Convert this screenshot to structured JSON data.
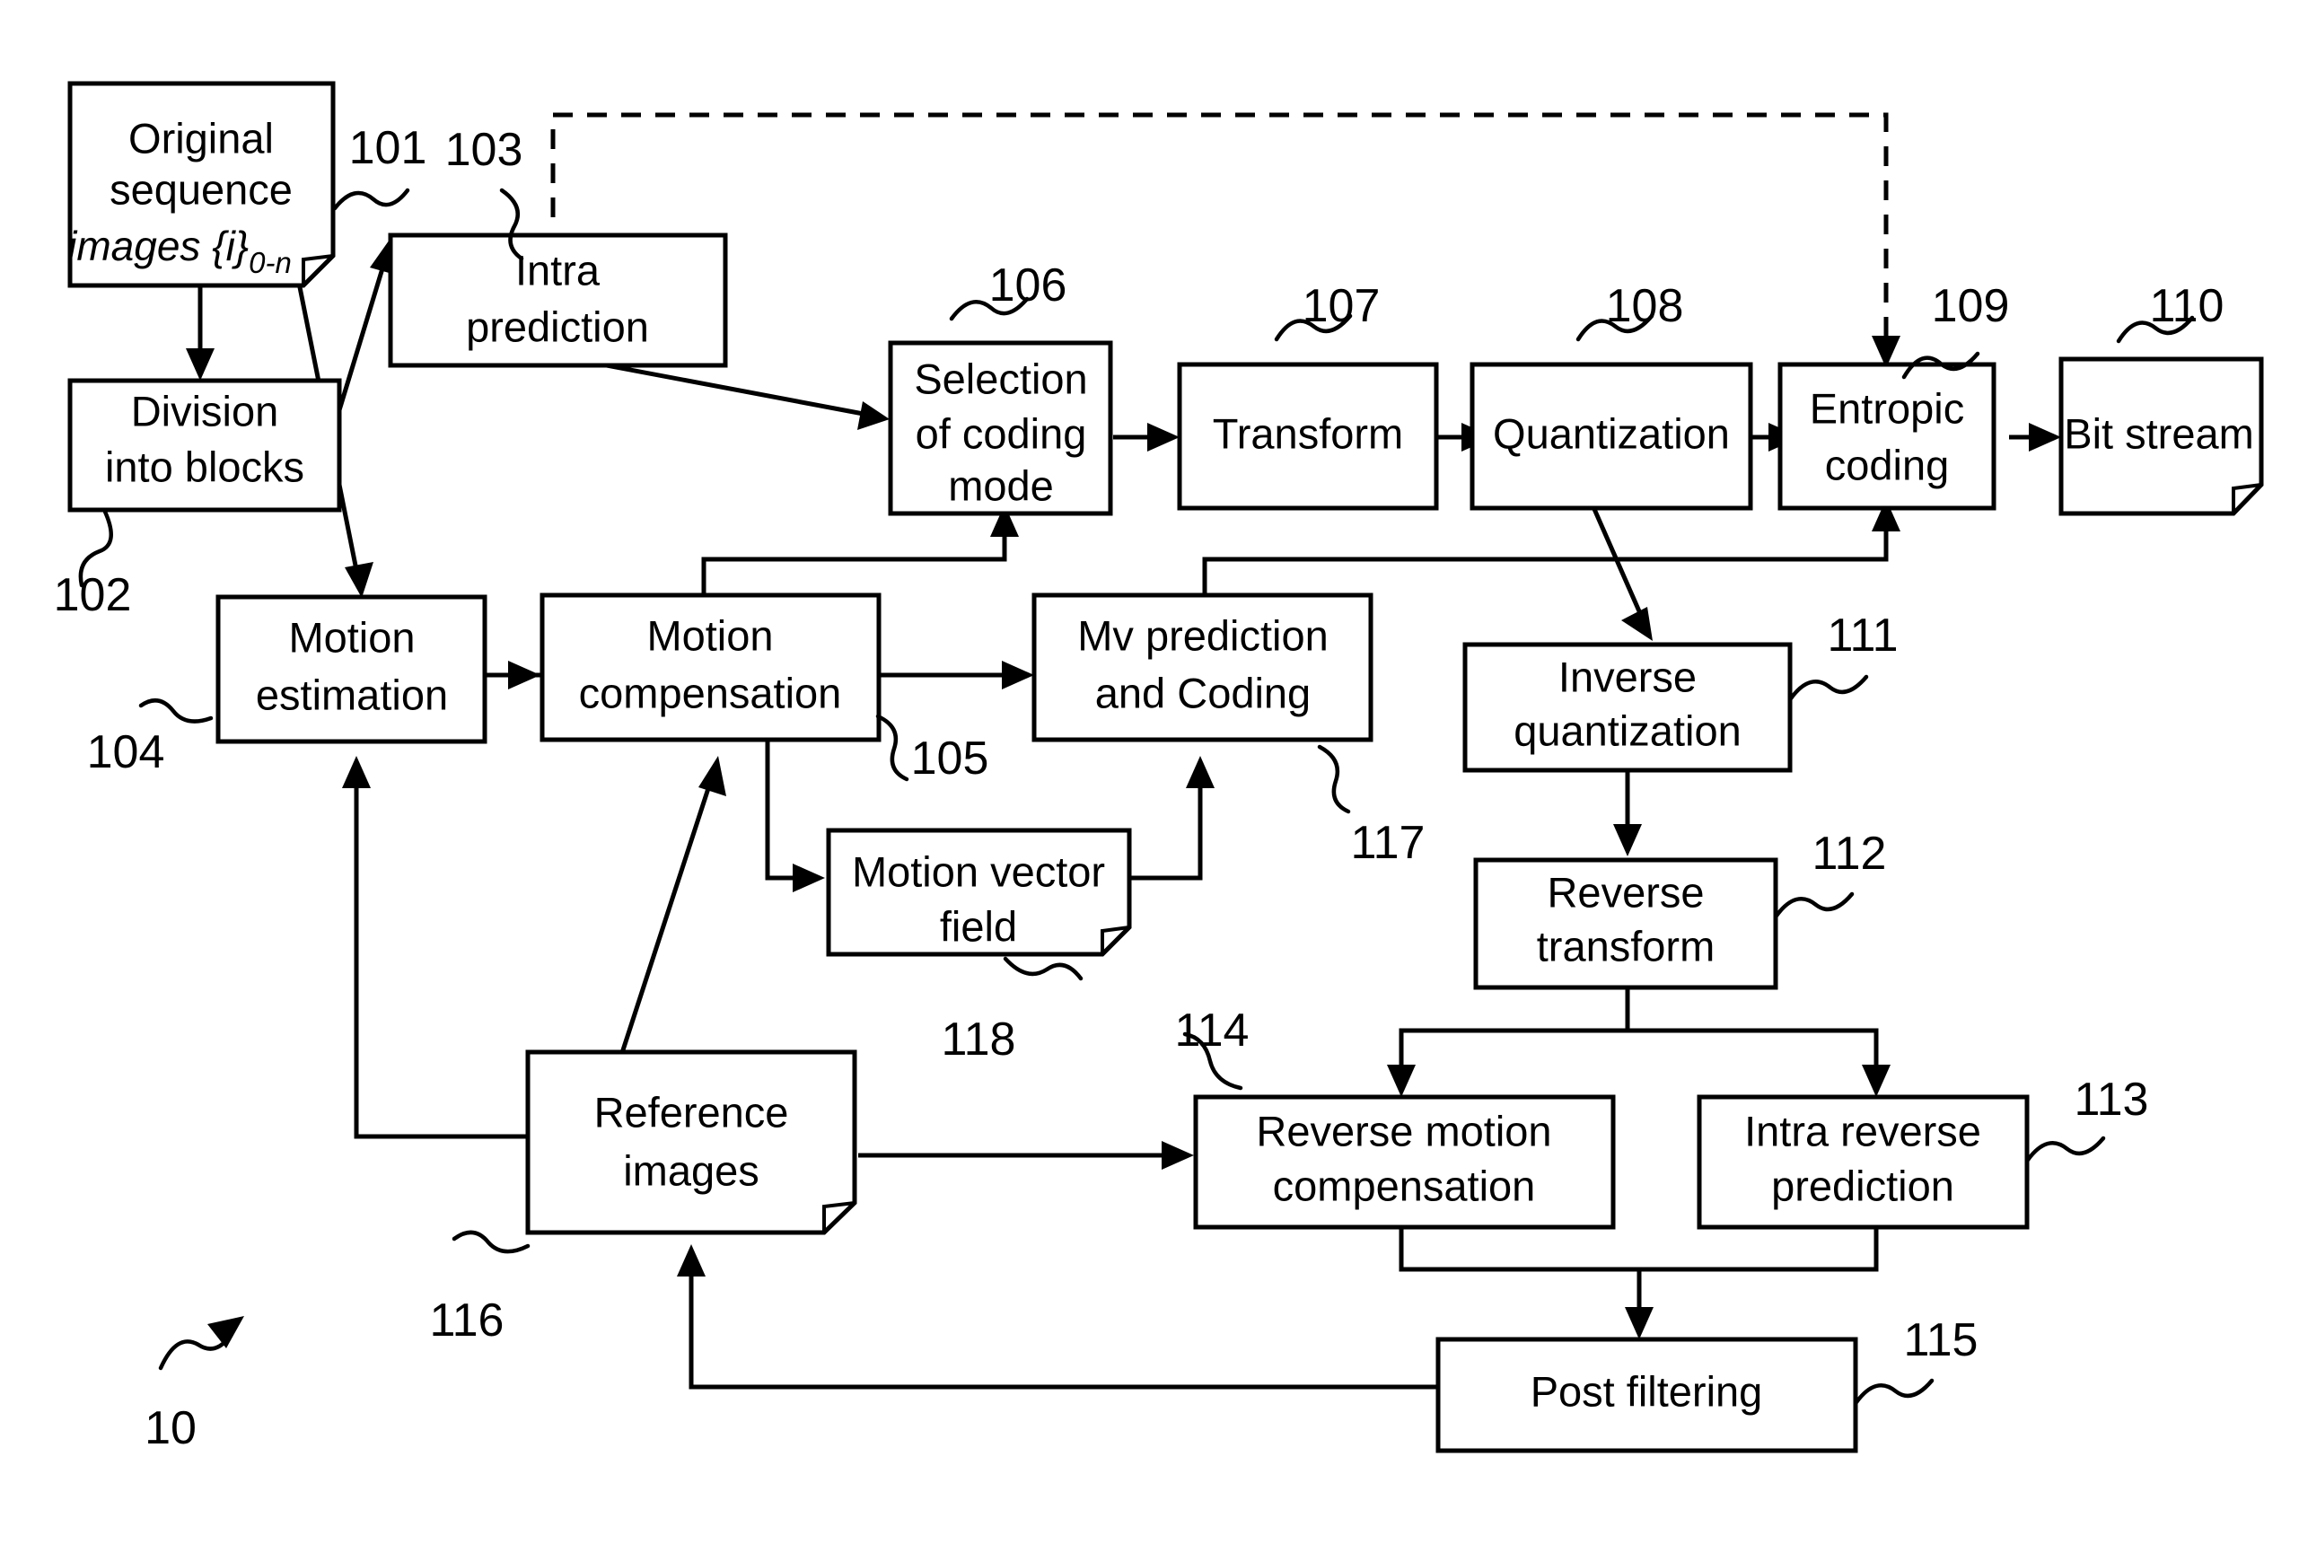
{
  "figure": {
    "figure_ref": "10",
    "background": "#ffffff",
    "ink": "#000000"
  },
  "blocks": [
    {
      "id": "original-sequence",
      "ref": "101",
      "line1": "Original",
      "line2": "sequence",
      "line3_italic": "images {i}",
      "line3_sub": "0-n",
      "shape": "document"
    },
    {
      "id": "division-into-blocks",
      "ref": "102",
      "line1": "Division",
      "line2": "into blocks",
      "shape": "rect"
    },
    {
      "id": "intra-prediction",
      "ref": "103",
      "line1": "Intra",
      "line2": "prediction",
      "shape": "rect"
    },
    {
      "id": "motion-estimation",
      "ref": "104",
      "line1": "Motion",
      "line2": "estimation",
      "shape": "rect"
    },
    {
      "id": "motion-compensation",
      "ref": "105",
      "line1": "Motion",
      "line2": "compensation",
      "shape": "rect"
    },
    {
      "id": "selection-of-coding-mode",
      "ref": "106",
      "line1": "Selection",
      "line2": "of coding",
      "line3": "mode",
      "shape": "rect"
    },
    {
      "id": "transform",
      "ref": "107",
      "line1": "Transform",
      "shape": "rect"
    },
    {
      "id": "quantization",
      "ref": "108",
      "line1": "Quantization",
      "shape": "rect"
    },
    {
      "id": "entropic-coding",
      "ref": "109",
      "line1": "Entropic",
      "line2": "coding",
      "shape": "rect"
    },
    {
      "id": "bit-stream",
      "ref": "110",
      "line1": "Bit stream",
      "shape": "document"
    },
    {
      "id": "inverse-quantization",
      "ref": "111",
      "line1": "Inverse",
      "line2": "quantization",
      "shape": "rect"
    },
    {
      "id": "reverse-transform",
      "ref": "112",
      "line1": "Reverse",
      "line2": "transform",
      "shape": "rect"
    },
    {
      "id": "intra-reverse-prediction",
      "ref": "113",
      "line1": "Intra reverse",
      "line2": "prediction",
      "shape": "rect"
    },
    {
      "id": "reverse-motion-compensation",
      "ref": "114",
      "line1": "Reverse motion",
      "line2": "compensation",
      "shape": "rect"
    },
    {
      "id": "post-filtering",
      "ref": "115",
      "line1": "Post filtering",
      "shape": "rect"
    },
    {
      "id": "reference-images",
      "ref": "116",
      "line1": "Reference",
      "line2": "images",
      "shape": "document"
    },
    {
      "id": "mv-prediction-and-coding",
      "ref": "117",
      "line1": "Mv prediction",
      "line2": "and Coding",
      "shape": "rect"
    },
    {
      "id": "motion-vector-field",
      "ref": "118",
      "line1": "Motion vector",
      "line2": "field",
      "shape": "document"
    }
  ],
  "text": {
    "b101_l1": "Original",
    "b101_l2": "sequence",
    "b101_l3": "images {i}",
    "b101_sub": "0-n",
    "b102_l1": "Division",
    "b102_l2": "into blocks",
    "b103_l1": "Intra",
    "b103_l2": "prediction",
    "b104_l1": "Motion",
    "b104_l2": "estimation",
    "b105_l1": "Motion",
    "b105_l2": "compensation",
    "b106_l1": "Selection",
    "b106_l2": "of coding",
    "b106_l3": "mode",
    "b107_l1": "Transform",
    "b108_l1": "Quantization",
    "b109_l1": "Entropic",
    "b109_l2": "coding",
    "b110_l1": "Bit stream",
    "b111_l1": "Inverse",
    "b111_l2": "quantization",
    "b112_l1": "Reverse",
    "b112_l2": "transform",
    "b113_l1": "Intra reverse",
    "b113_l2": "prediction",
    "b114_l1": "Reverse motion",
    "b114_l2": "compensation",
    "b115_l1": "Post filtering",
    "b116_l1": "Reference",
    "b116_l2": "images",
    "b117_l1": "Mv prediction",
    "b117_l2": "and Coding",
    "b118_l1": "Motion vector",
    "b118_l2": "field"
  },
  "ref_numbers": {
    "n10": "10",
    "n101": "101",
    "n102": "102",
    "n103": "103",
    "n104": "104",
    "n105": "105",
    "n106": "106",
    "n107": "107",
    "n108": "108",
    "n109": "109",
    "n110": "110",
    "n111": "111",
    "n112": "112",
    "n113": "113",
    "n114": "114",
    "n115": "115",
    "n116": "116",
    "n117": "117",
    "n118": "118"
  }
}
